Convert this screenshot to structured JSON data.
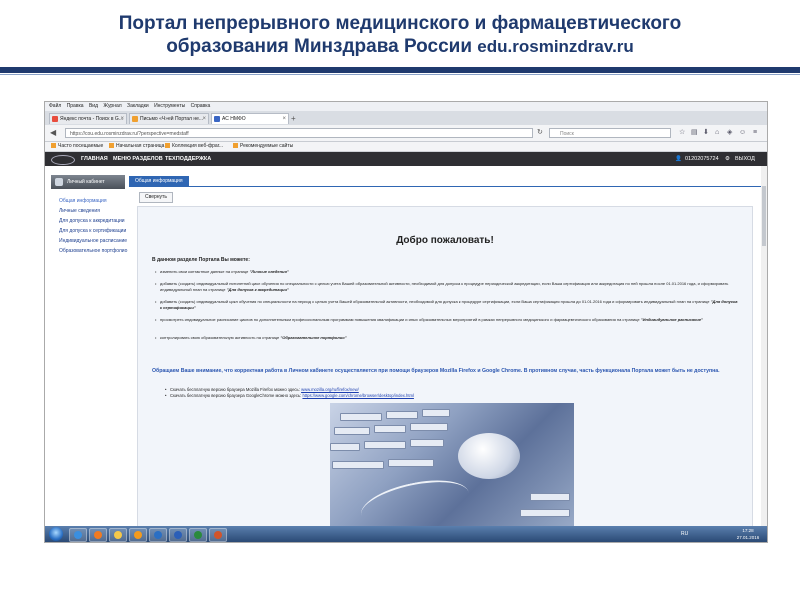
{
  "slide": {
    "title_line1": "Портал непрерывного медицинского и фармацевтического",
    "title_line2": "образования Минздрава России",
    "title_url": "edu.rosminzdrav.ru"
  },
  "browser": {
    "menu": [
      "Файл",
      "Правка",
      "Вид",
      "Журнал",
      "Закладки",
      "Инструменты",
      "Справка"
    ],
    "tabs": [
      {
        "label": "Яндекс почта - Поиск в G...",
        "color": "#e84c3d"
      },
      {
        "label": "Письмо «Ч»ей Портал не...",
        "color": "#f0a030"
      },
      {
        "label": "АС НМФО",
        "color": "#3a66c4"
      }
    ],
    "new_tab": "+",
    "url": "https://cou.edu.rosminzdrav.ru/?perspective=medstaff",
    "search_placeholder": "Поиск",
    "bookmarks": [
      "Часто посещаемые",
      "Начальная страница",
      "Коллекция веб-фраг...",
      "Рекомендуемые сайты"
    ]
  },
  "site": {
    "nav": [
      "ГЛАВНАЯ",
      "МЕНЮ РАЗДЕЛОВ",
      "ТЕХПОДДЕРЖКА"
    ],
    "user": "01202075724",
    "logout": "ВЫХОД",
    "sidebar_title": "Личный кабинет",
    "sidebar_items": [
      "Общая информация",
      "Личные сведения",
      "Для допуска к аккредитации",
      "Для допуска к сертификации",
      "Индивидуальное расписание",
      "Образовательное портфолио"
    ],
    "content_tab": "Общая информация",
    "collapse_button": "Свернуть",
    "welcome": "Добро пожаловать!",
    "intro": "В данном разделе Портала Вы можете:",
    "bullets": [
      {
        "text": "изменить свои контактные данные на странице",
        "em": "\"Личные сведения\""
      },
      {
        "text": "добавить (создать) индивидуальный пятилетний цикл обучения по специальности с целью учета Вашей образовательной активности, необходимой для допуска к процедуре периодической аккредитации, если Ваша сертификация или аккредитация по ней прошла после 01.01.2016 года, и сформировать индивидуальный план на странице",
        "em": "\"Для допуска к аккредитации\""
      },
      {
        "text": "добавить (создать) индивидуальный цикл обучения по специальности на период с целью учета Вашей образовательной активности, необходимой для допуска к процедуре сертификации, если Ваша сертификация прошла до 01.01.2016 года и сформировать индивидуальный план на странице",
        "em": "\"Для допуска к сертификации\""
      },
      {
        "text": "просмотреть индивидуальное расписание циклов по дополнительным профессиональным программам повышения квалификации и иных образовательных мероприятий в рамках непрерывного медицинского и фармацевтического образования на странице",
        "em": "\"Индивидуальное расписание\""
      },
      {
        "text": "контролировать свою образовательную активность на странице",
        "em": "\"Образовательное портфолио\""
      }
    ],
    "notice": "Обращаем Ваше внимание, что корректная работа в Личном кабинете осуществляется при помощи браузеров Mozilla Firefox и Google Chrome. В противном случае, часть функционала Портала может быть не доступна.",
    "downloads": [
      {
        "text": "Скачать бесплатную версию браузера Mozilla Firefox можно здесь:",
        "link": "www.mozilla.org/ru/firefox/new/"
      },
      {
        "text": "Скачать бесплатную версию браузера GoogleChrome можно здесь:",
        "link": "https://www.google.com/chrome/browser/desktop/index.html"
      }
    ]
  },
  "taskbar": {
    "lang": "RU",
    "time": "17:28",
    "date": "27.01.2016",
    "apps": [
      {
        "icon": "internet-explorer-icon",
        "color": "#3a8fe0"
      },
      {
        "icon": "firefox-icon",
        "color": "#f07a20"
      },
      {
        "icon": "folder-icon",
        "color": "#f5c84a"
      },
      {
        "icon": "media-player-icon",
        "color": "#f39a1c"
      },
      {
        "icon": "outlook-icon",
        "color": "#2a6fc4"
      },
      {
        "icon": "word-icon",
        "color": "#2b5fb8"
      },
      {
        "icon": "excel-icon",
        "color": "#2a8a3c"
      },
      {
        "icon": "powerpoint-icon",
        "color": "#d2542a"
      }
    ]
  },
  "colors": {
    "title": "#1f3a6e",
    "accent": "#2f66b3",
    "notice": "#2b56b0"
  }
}
